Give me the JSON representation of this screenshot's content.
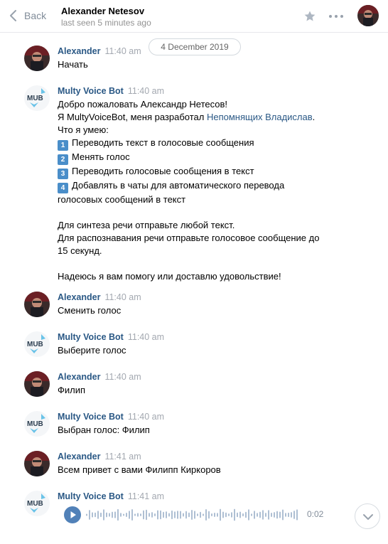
{
  "header": {
    "back_label": "Back",
    "peer_name": "Alexander Netesov",
    "peer_status": "last seen 5 minutes ago"
  },
  "date_separator": "4 December 2019",
  "users": {
    "alexander": "Alexander",
    "bot": "Multy Voice Bot"
  },
  "messages": [
    {
      "time": "11:40 am",
      "text": "Начать"
    },
    {
      "time": "11:40 am",
      "greeting": "Добро пожаловать Александр Нетесов!",
      "dev_prefix": "Я MultyVoiceBot, меня разработал ",
      "dev_link": "Непомнящих Владислав",
      "dev_suffix": ".",
      "can_label": "Что я умею:",
      "items": [
        {
          "num": "1",
          "text": "Переводить текст в голосовые сообщения"
        },
        {
          "num": "2",
          "text": "Менять голос"
        },
        {
          "num": "3",
          "text": "Переводить голосовые сообщения в текст"
        },
        {
          "num": "4",
          "text": "Добавлять в чаты для автоматического перевода\nголосовых сообщений в текст"
        }
      ],
      "tail": "Для синтеза речи отправьте любой текст.\nДля распознавания речи отправьте голосовое сообщение до\n15 секунд.\n\nНадеюсь я вам помогу или доставлю удовольствие!"
    },
    {
      "time": "11:40 am",
      "text": "Сменить голос"
    },
    {
      "time": "11:40 am",
      "text": "Выберите голос"
    },
    {
      "time": "11:40 am",
      "text": "Филип"
    },
    {
      "time": "11:40 am",
      "text": "Выбран голос: Филип"
    },
    {
      "time": "11:41 am",
      "text": "Всем привет с вами Филипп Киркоров"
    },
    {
      "time": "11:41 am",
      "audio_duration": "0:02"
    }
  ],
  "icons": {
    "back": "chevron-left-icon",
    "star": "star-icon",
    "more": "more-dots-icon",
    "play": "play-icon",
    "scroll": "chevron-down-icon"
  },
  "colors": {
    "link": "#2a5885",
    "accent": "#5181b8",
    "meta": "#a3a8b0",
    "number_badge": "#4a8ec9"
  }
}
